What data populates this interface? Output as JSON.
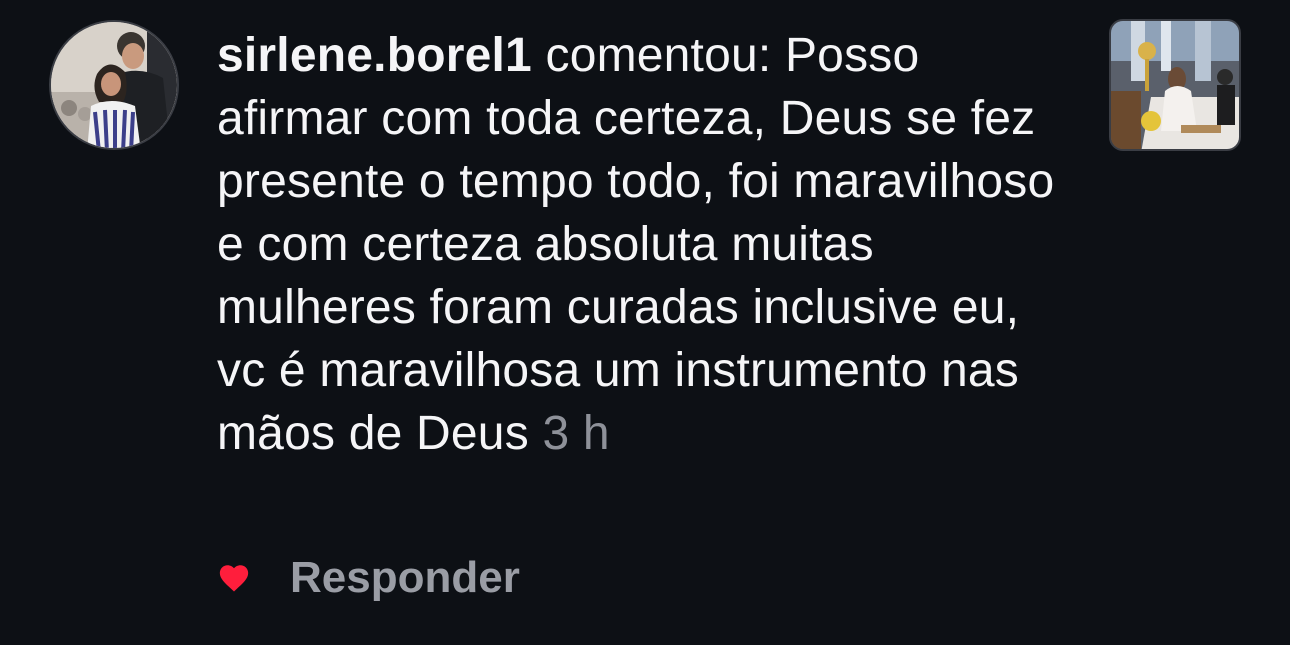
{
  "comment": {
    "username": "sirlene.borel1",
    "verb": " comentou: ",
    "text": "Posso afirmar com toda certeza, Deus se fez presente o tempo todo, foi maravilhoso e com certeza absoluta muitas mulheres foram curadas inclusive eu, vc é maravilhosa um instrumento nas mãos de Deus",
    "time": "3 h"
  },
  "actions": {
    "like_icon": "heart-icon",
    "like_color": "#ff1e3c",
    "reply_label": "Responder"
  },
  "colors": {
    "background": "#0d1015",
    "text": "#f5f5f7",
    "muted": "#8e9199"
  }
}
